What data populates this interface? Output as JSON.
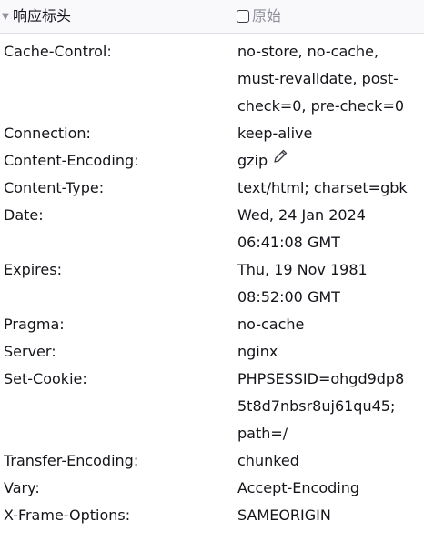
{
  "section": {
    "toggle_icon": "triangle-down-icon",
    "title": "响应标头",
    "raw_label": "原始",
    "raw_checked": false
  },
  "headers": [
    {
      "name": "Cache-Control:",
      "value_lines": [
        "no-store, no-cache,",
        "must-revalidate, post-",
        "check=0, pre-check=0"
      ]
    },
    {
      "name": "Connection:",
      "value_lines": [
        "keep-alive"
      ]
    },
    {
      "name": "Content-Encoding:",
      "value_lines": [
        "gzip"
      ],
      "icon": "pencil-edit-icon"
    },
    {
      "name": "Content-Type:",
      "value_lines": [
        "text/html; charset=gbk"
      ]
    },
    {
      "name": "Date:",
      "value_lines": [
        "Wed, 24 Jan 2024",
        "06:41:08 GMT"
      ]
    },
    {
      "name": "Expires:",
      "value_lines": [
        "Thu, 19 Nov 1981",
        "08:52:00 GMT"
      ]
    },
    {
      "name": "Pragma:",
      "value_lines": [
        "no-cache"
      ]
    },
    {
      "name": "Server:",
      "value_lines": [
        "nginx"
      ]
    },
    {
      "name": "Set-Cookie:",
      "value_lines": [
        "PHPSESSID=ohgd9dp8",
        "5t8d7nbsr8uj61qu45;",
        "path=/"
      ]
    },
    {
      "name": "Transfer-Encoding:",
      "value_lines": [
        "chunked"
      ]
    },
    {
      "name": "Vary:",
      "value_lines": [
        "Accept-Encoding"
      ]
    },
    {
      "name": "X-Frame-Options:",
      "value_lines": [
        "SAMEORIGIN"
      ]
    }
  ]
}
